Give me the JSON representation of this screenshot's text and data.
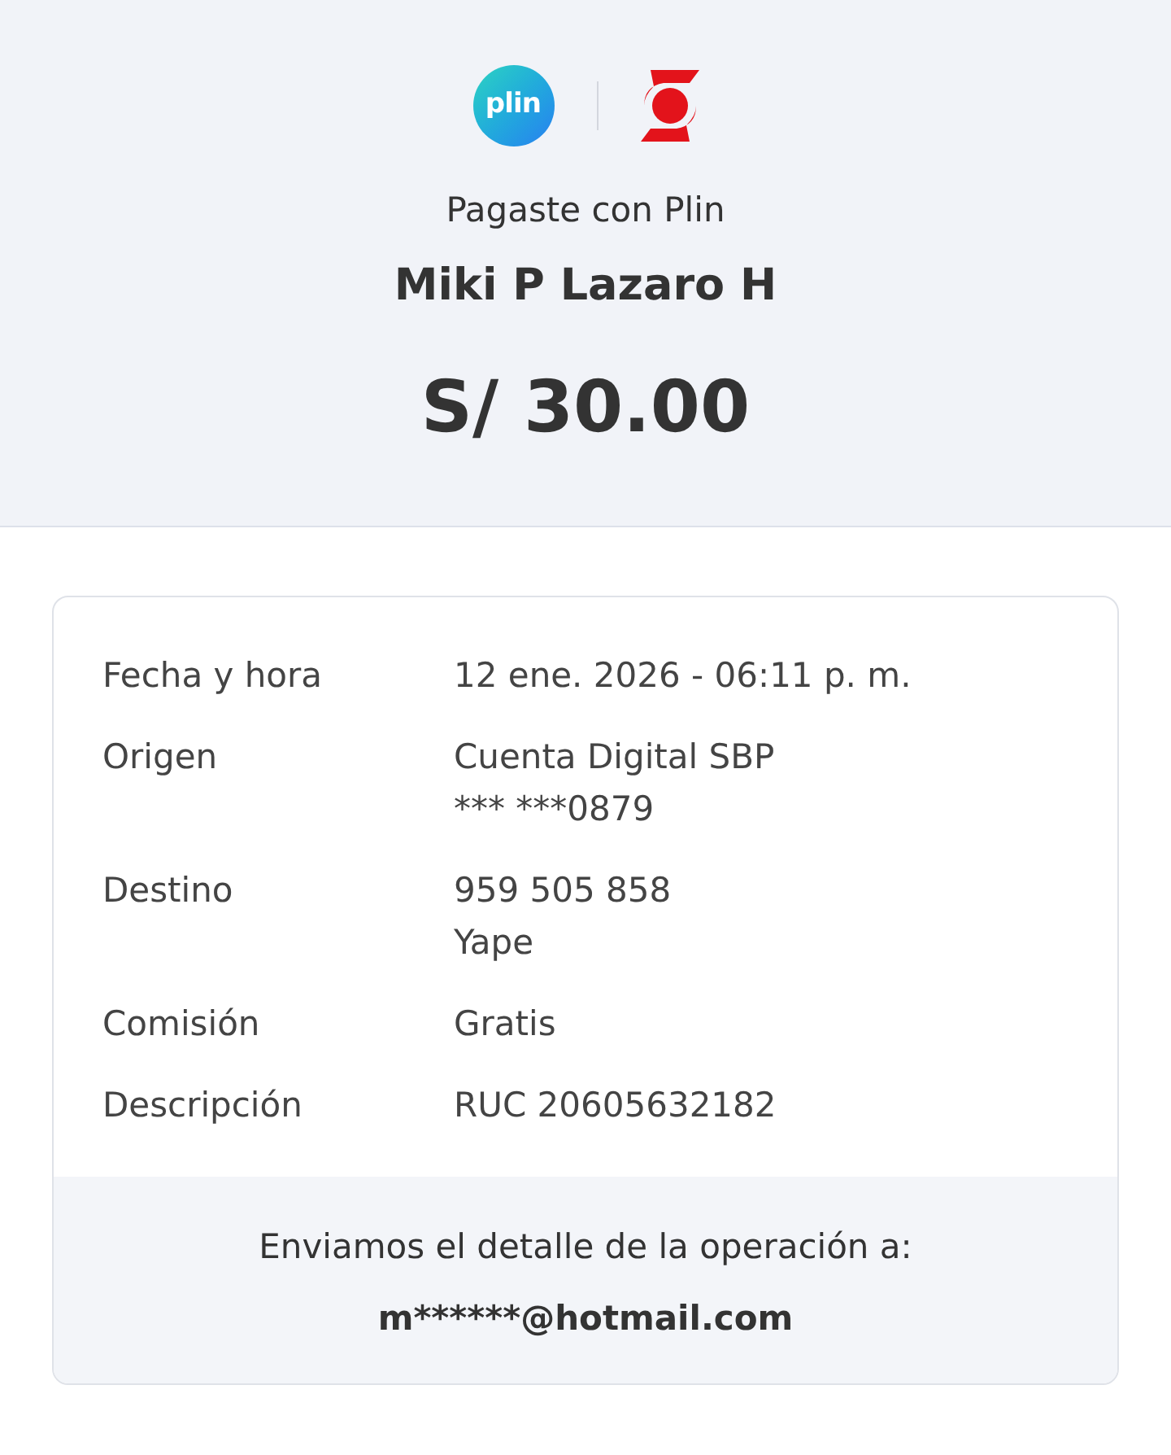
{
  "header": {
    "logo_text": "plin",
    "title": "Pagaste con Plin",
    "recipient": "Miki P Lazaro H",
    "amount": "S/ 30.00"
  },
  "details": [
    {
      "label": "Fecha y hora",
      "lines": [
        "12 ene. 2026 - 06:11 p. m."
      ]
    },
    {
      "label": "Origen",
      "lines": [
        "Cuenta Digital SBP",
        "*** ***0879"
      ]
    },
    {
      "label": "Destino",
      "lines": [
        "959 505 858",
        "Yape"
      ]
    },
    {
      "label": "Comisión",
      "lines": [
        "Gratis"
      ]
    },
    {
      "label": "Descripción",
      "lines": [
        "RUC 20605632182"
      ]
    }
  ],
  "footer": {
    "message": "Enviamos el detalle de la operación a:",
    "email": "m******@hotmail.com"
  }
}
